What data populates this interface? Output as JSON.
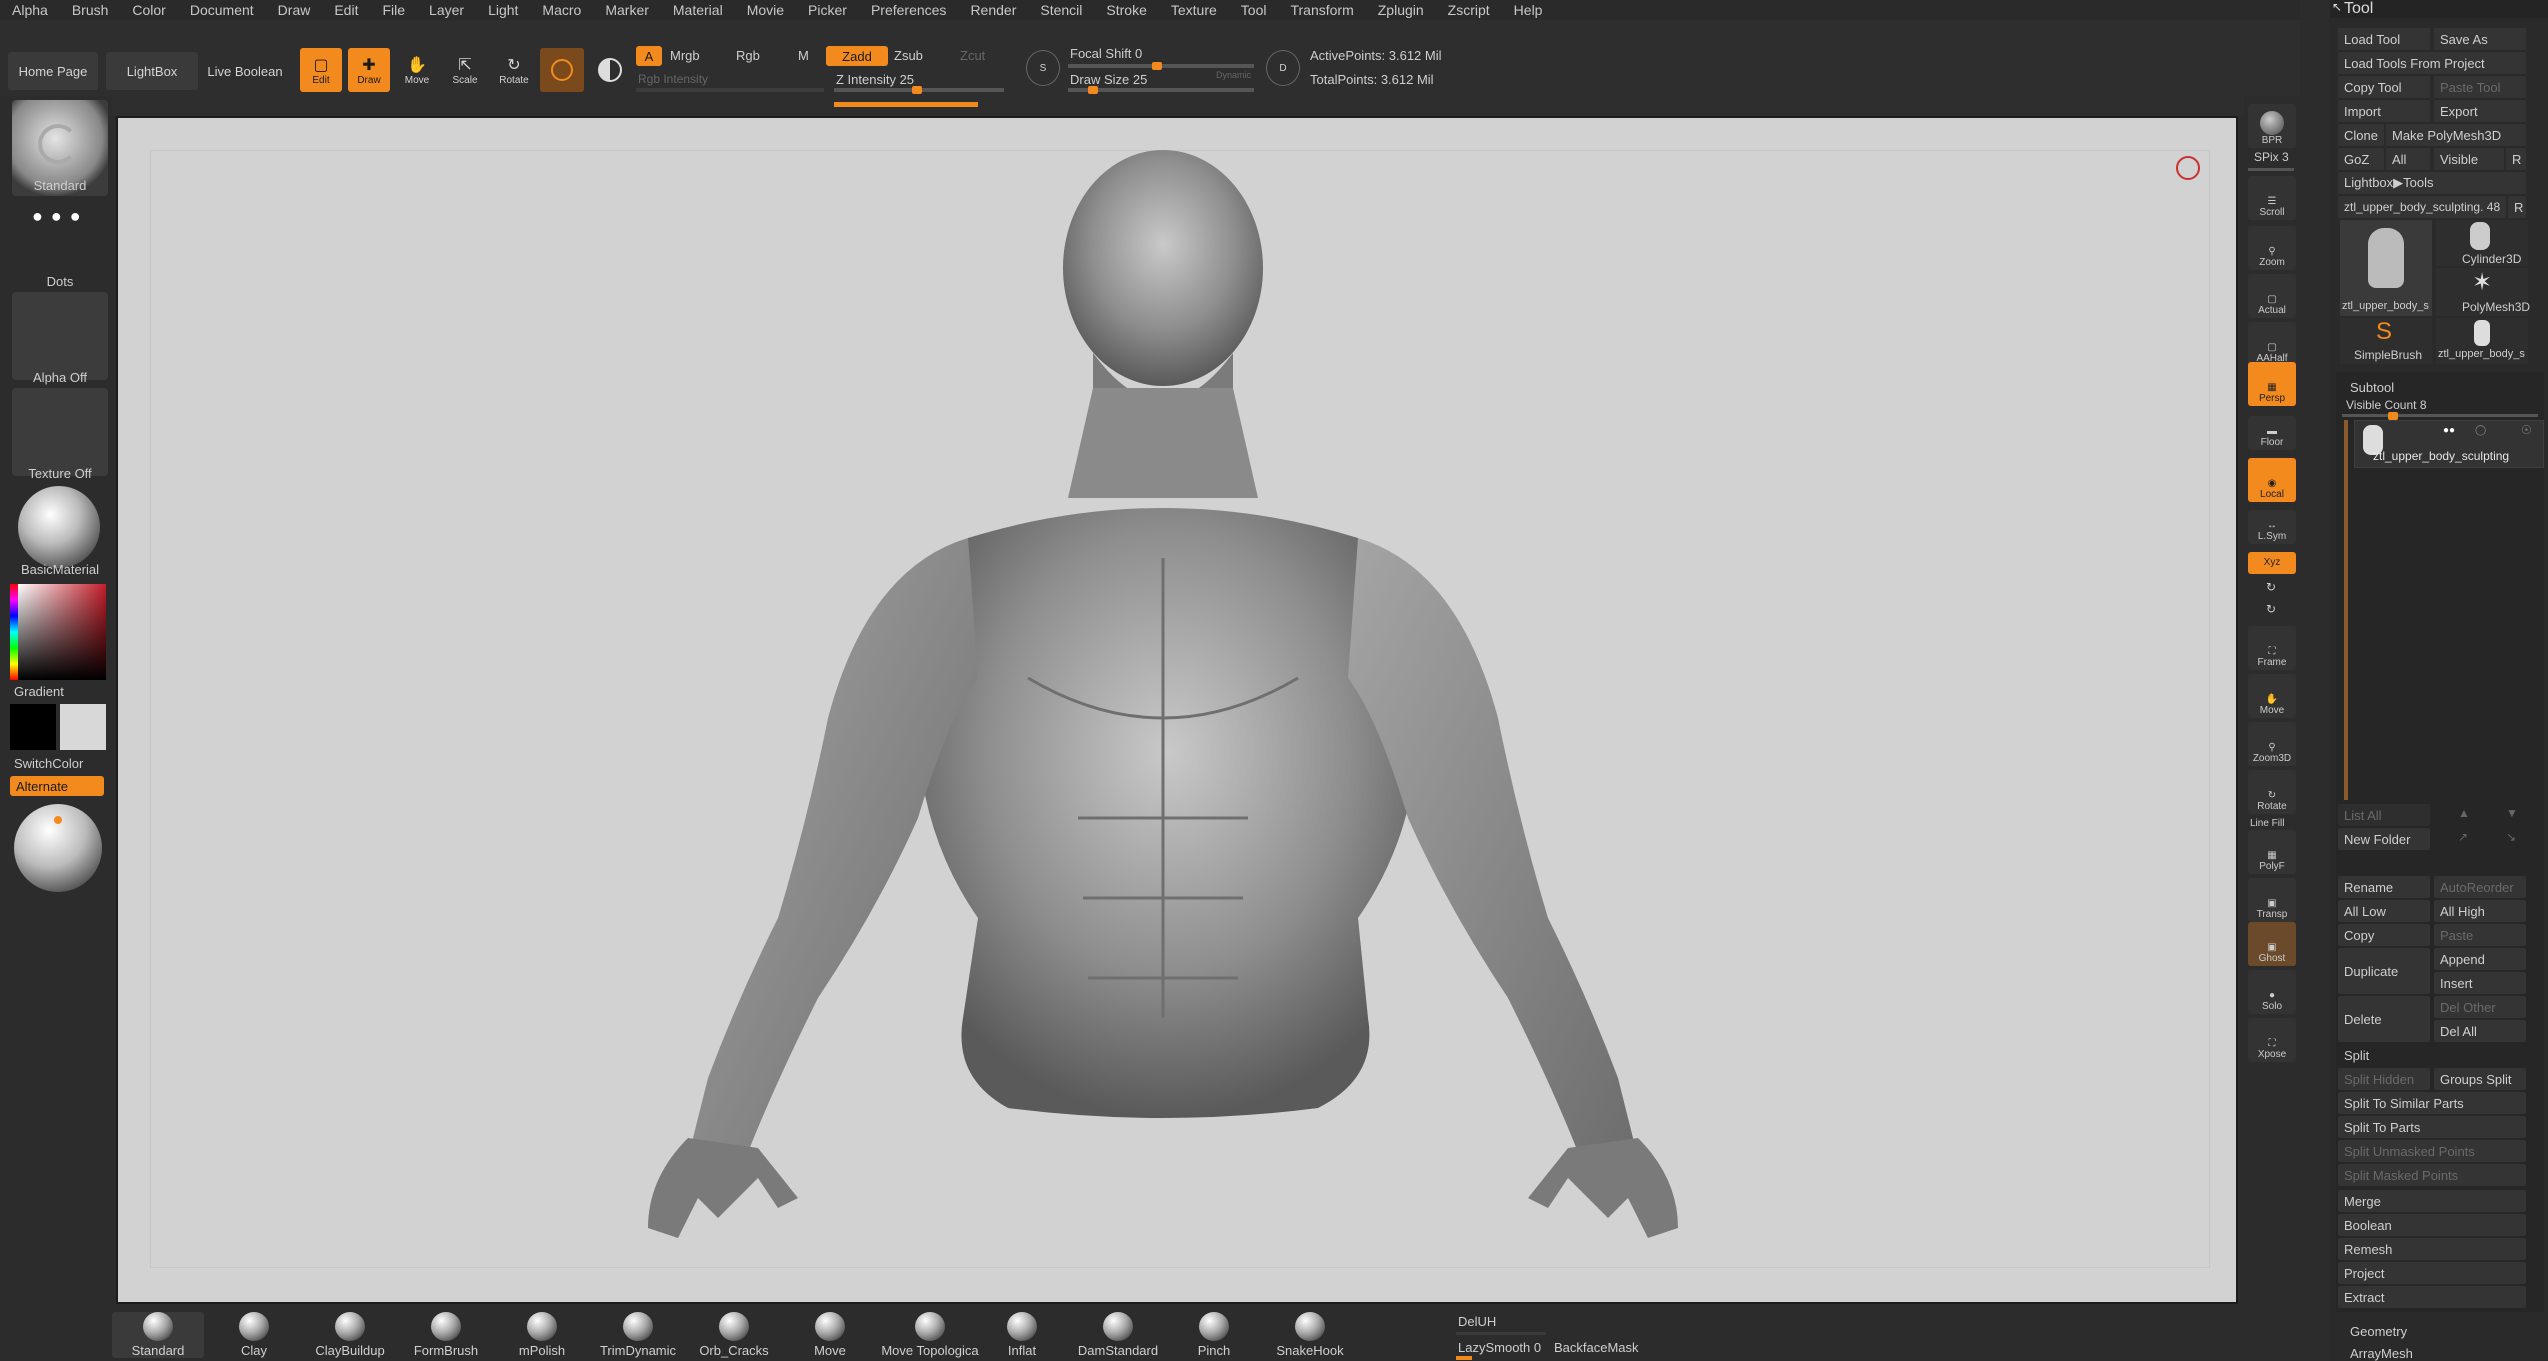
{
  "menu": [
    "Alpha",
    "Brush",
    "Color",
    "Document",
    "Draw",
    "Edit",
    "File",
    "Layer",
    "Light",
    "Macro",
    "Marker",
    "Material",
    "Movie",
    "Picker",
    "Preferences",
    "Render",
    "Stencil",
    "Stroke",
    "Texture",
    "Tool",
    "Transform",
    "Zplugin",
    "Zscript",
    "Help"
  ],
  "toolbar": {
    "home": "Home Page",
    "lightbox": "LightBox",
    "live_boolean": "Live Boolean",
    "edit": "Edit",
    "draw": "Draw",
    "move": "Move",
    "scale": "Scale",
    "rotate": "Rotate",
    "a": "A",
    "mrgb": "Mrgb",
    "rgb": "Rgb",
    "m": "M",
    "rgb_intensity": "Rgb Intensity",
    "zadd": "Zadd",
    "zsub": "Zsub",
    "zcut": "Zcut",
    "z_intensity": "Z Intensity 25",
    "z_intensity_value": 25,
    "focal_shift": "Focal Shift 0",
    "draw_size": "Draw Size 25",
    "dynamic": "Dynamic",
    "active_points": "ActivePoints: 3.612 Mil",
    "total_points": "TotalPoints: 3.612 Mil"
  },
  "shelf": {
    "standard": "Standard",
    "dots": "Dots",
    "alpha_off": "Alpha Off",
    "texture_off": "Texture Off",
    "material": "BasicMaterial",
    "gradient": "Gradient",
    "switchcolor": "SwitchColor",
    "alternate": "Alternate"
  },
  "nav": [
    "BPR",
    "SPix 3",
    "Scroll",
    "Zoom",
    "Actual",
    "AAHalf",
    "Persp",
    "Floor",
    "Local",
    "L.Sym",
    "Xyz",
    "Frame",
    "Move",
    "Zoom3D",
    "Rotate",
    "Line Fill",
    "PolyF",
    "Transp",
    "Ghost",
    "Solo",
    "Xpose"
  ],
  "tool": {
    "title": "Tool",
    "load_tool": "Load Tool",
    "save_as": "Save As",
    "load_from_project": "Load Tools From Project",
    "copy_tool": "Copy Tool",
    "paste_tool": "Paste Tool",
    "import": "Import",
    "export": "Export",
    "clone": "Clone",
    "make_polymesh": "Make PolyMesh3D",
    "goz": "GoZ",
    "all": "All",
    "visible": "Visible",
    "r": "R",
    "lightbox_tools": "Lightbox▶Tools",
    "current_tool": "ztl_upper_body_sculpting. 48",
    "thumbs": [
      "ztl_upper_body_s",
      "Cylinder3D",
      "PolyMesh3D",
      "SimpleBrush",
      "ztl_upper_body_s"
    ],
    "subtool": "Subtool",
    "visible_count": "Visible Count 8",
    "subtool_item": "ztl_upper_body_sculpting",
    "list_all": "List All",
    "new_folder": "New Folder",
    "rename": "Rename",
    "autoreorder": "AutoReorder",
    "all_low": "All Low",
    "all_high": "All High",
    "copy": "Copy",
    "paste": "Paste",
    "duplicate": "Duplicate",
    "append": "Append",
    "insert": "Insert",
    "delete": "Delete",
    "del_other": "Del Other",
    "del_all": "Del All",
    "split": "Split",
    "split_hidden": "Split Hidden",
    "groups_split": "Groups Split",
    "split_similar": "Split To Similar Parts",
    "split_parts": "Split To Parts",
    "split_unmasked": "Split Unmasked Points",
    "split_masked": "Split Masked Points",
    "merge": "Merge",
    "boolean": "Boolean",
    "remesh": "Remesh",
    "project": "Project",
    "extract": "Extract",
    "geometry": "Geometry",
    "arraymesh": "ArrayMesh"
  },
  "brushes": [
    "Standard",
    "Clay",
    "ClayBuildup",
    "FormBrush",
    "mPolish",
    "TrimDynamic",
    "Orb_Cracks",
    "Move",
    "Move Topologica",
    "Inflat",
    "DamStandard",
    "Pinch",
    "SnakeHook"
  ],
  "bottom": {
    "deluh": "DelUH",
    "lazysmooth": "LazySmooth 0",
    "backfacemask": "BackfaceMask"
  },
  "colors": {
    "accent": "#f28a1e",
    "viewport": "#d2d2d2"
  }
}
